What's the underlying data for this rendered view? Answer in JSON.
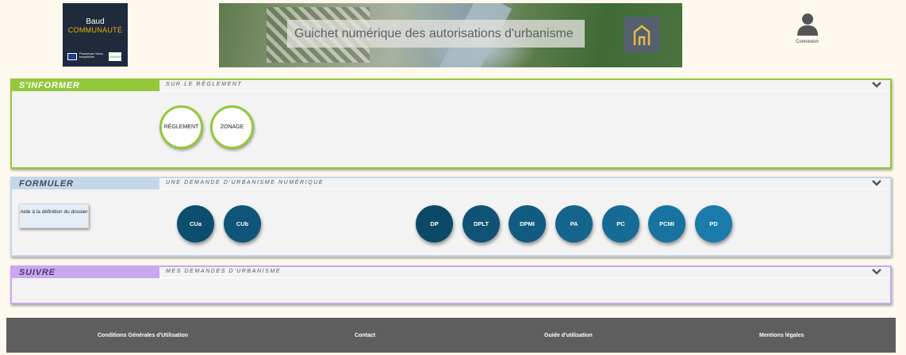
{
  "header": {
    "logo": {
      "line1": "Baud",
      "line2": "COMMUNAUTÉ",
      "eu_text": "Financé par l'Union européenne",
      "leader_text": "LEADER"
    },
    "banner_title": "Guichet numérique des autorisations d'urbanisme",
    "home_icon": "home-icon",
    "login_label": "Connexion",
    "login_icon": "user-icon"
  },
  "sections": {
    "informer": {
      "title": "S'INFORMER",
      "subtitle": "SUR LE RÈGLEMENT",
      "color": "#93c83a",
      "buttons": [
        "RÈGLEMENT",
        "ZONAGE"
      ]
    },
    "formuler": {
      "title": "FORMULER",
      "subtitle": "UNE DEMANDE D'URBANISME NUMÉRIQUE",
      "color": "#c4d6ea",
      "aide_label": "Aide à la définition du dossier",
      "buttons": [
        "CUa",
        "CUb",
        "DP",
        "DPLT",
        "DPMI",
        "PA",
        "PC",
        "PCMI",
        "PD"
      ]
    },
    "suivre": {
      "title": "SUIVRE",
      "subtitle": "MES DEMANDES D'URBANISME",
      "color": "#c9a8f0"
    }
  },
  "footer": {
    "links": [
      "Conditions Générales d'Utilisation",
      "Contact",
      "Guide d'utilisation",
      "Mentions légales"
    ]
  }
}
